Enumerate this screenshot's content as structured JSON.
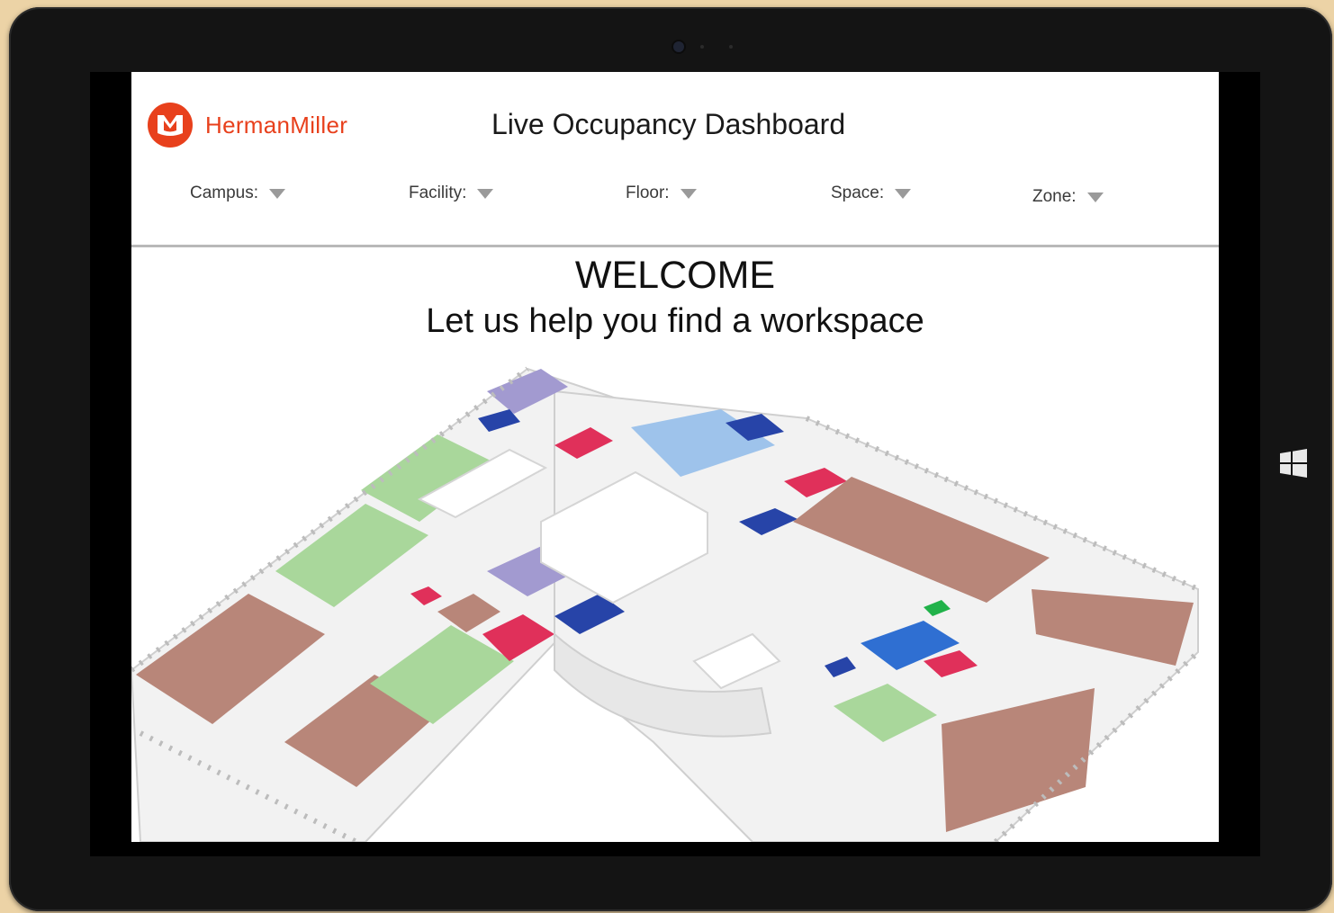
{
  "brand": {
    "name": "HermanMiller",
    "color": "#e8401c"
  },
  "dashboard_title": "Live Occupancy Dashboard",
  "filters": [
    {
      "label": "Campus:"
    },
    {
      "label": "Facility:"
    },
    {
      "label": "Floor:"
    },
    {
      "label": "Space:"
    },
    {
      "label": "Zone:"
    }
  ],
  "welcome": {
    "heading": "WELCOME",
    "subheading": "Let us help you find a workspace"
  },
  "zone_colors": {
    "open_desk": "#a9d79b",
    "office": "#b88679",
    "meeting": "#a29ad0",
    "focus": "#2744a8",
    "collab": "#e0305a",
    "lounge": "#9ec3eb"
  },
  "icons": {
    "logo": "herman-miller-logo-icon",
    "dropdown": "caret-down-icon",
    "windows": "windows-logo-icon"
  }
}
